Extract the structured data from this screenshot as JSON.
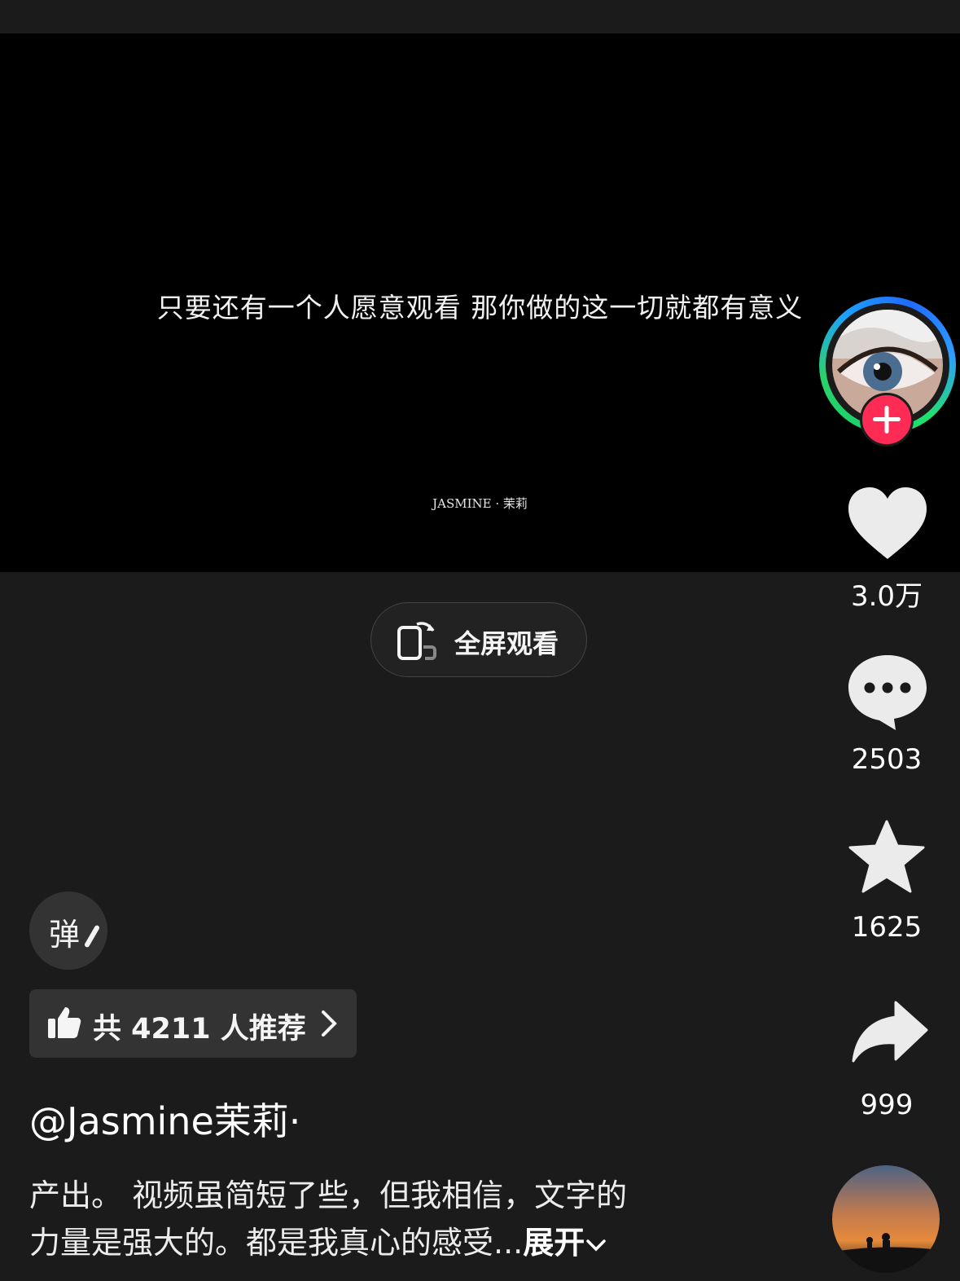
{
  "video": {
    "quote": "只要还有一个人愿意观看 那你做的这一切就都有意义",
    "watermark": "JASMINE · 茉莉"
  },
  "fullscreen": {
    "label": "全屏观看",
    "icon": "rotate-phone-icon"
  },
  "actions": {
    "like_count": "3.0万",
    "comment_count": "2503",
    "favorite_count": "1625",
    "share_count": "999"
  },
  "danmaku": {
    "label": "弹"
  },
  "recommend": {
    "label": "共 4211 人推荐"
  },
  "author": {
    "username": "@Jasmine茉莉·"
  },
  "description": {
    "line1": "产出。 视频虽简短了些，但我相信，文字的",
    "line2": "力量是强大的。都是我真心的感受...",
    "expand": "展开"
  },
  "colors": {
    "follow": "#fe2c55",
    "background": "#1b1b1b",
    "video": "#000000"
  }
}
